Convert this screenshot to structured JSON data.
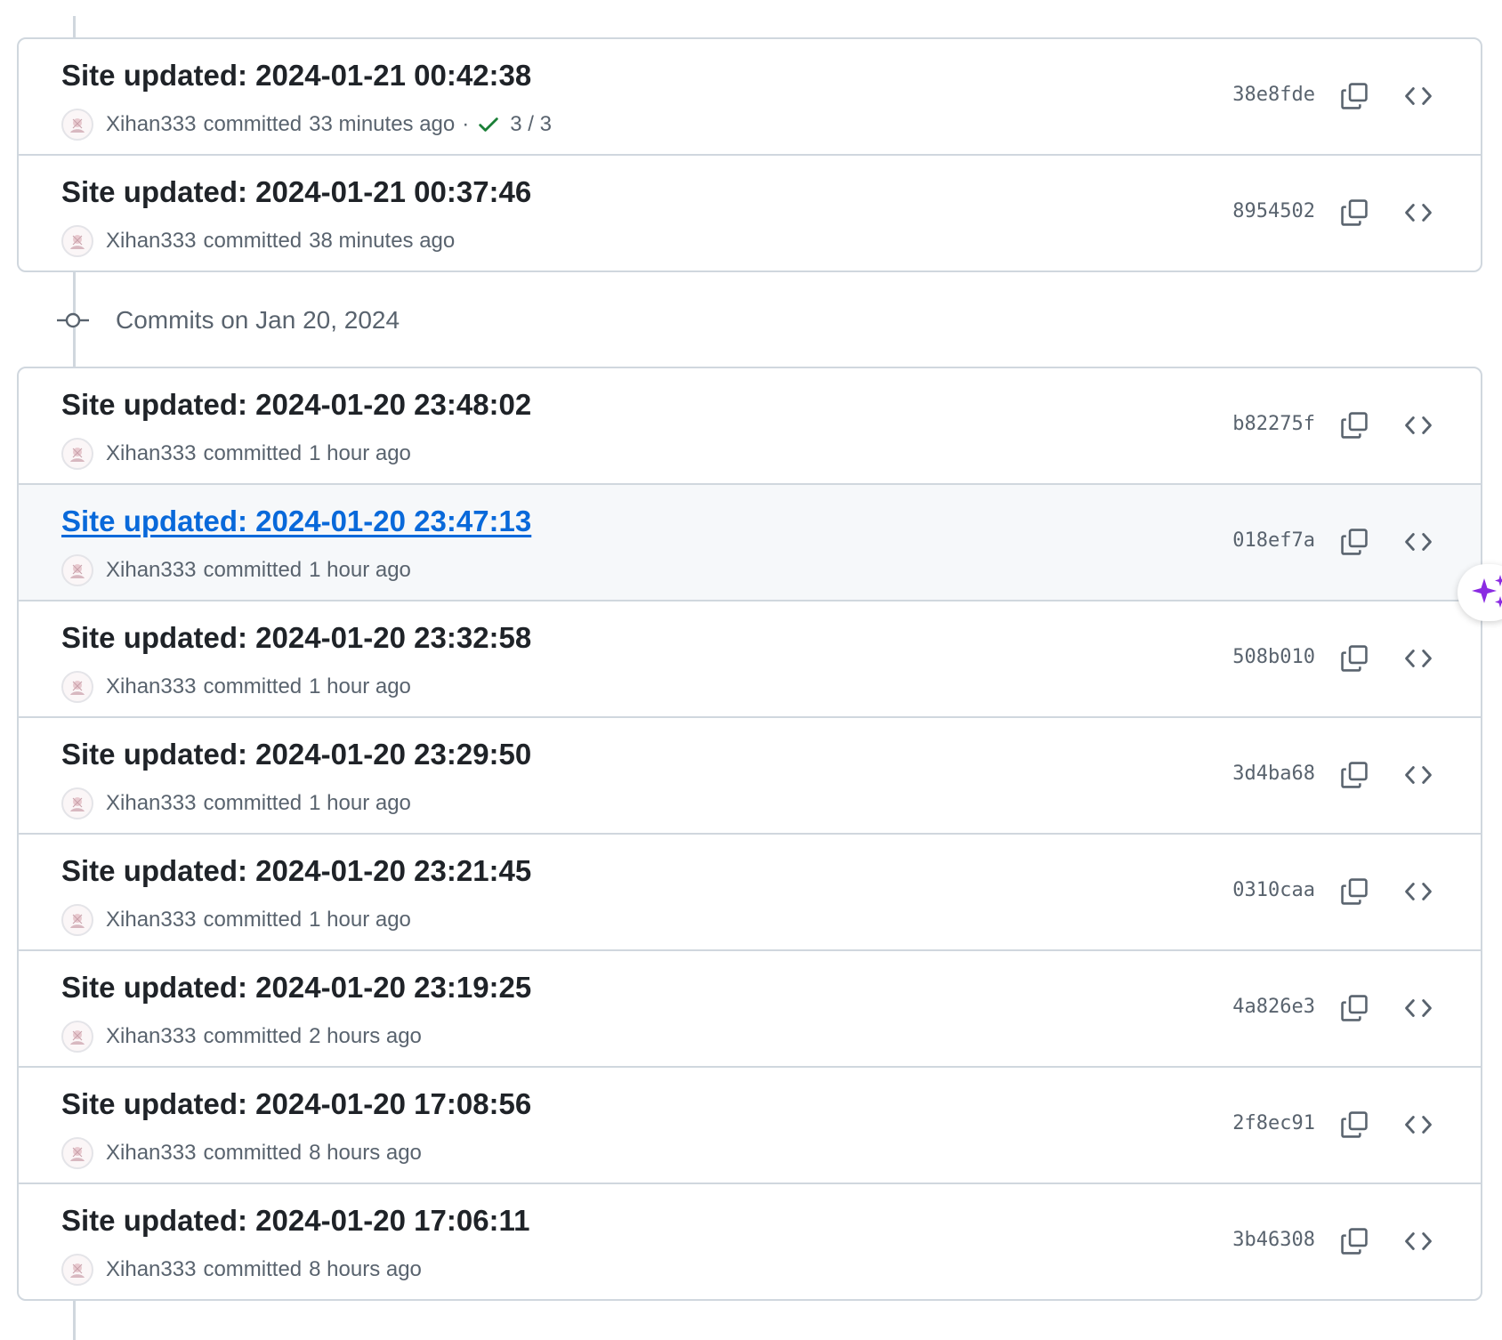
{
  "groups": [
    {
      "commits": [
        {
          "title": "Site updated: 2024-01-21 00:42:38",
          "author": "Xihan333",
          "action": "committed",
          "time": "33 minutes ago",
          "checks": "3 / 3",
          "sha": "38e8fde"
        },
        {
          "title": "Site updated: 2024-01-21 00:37:46",
          "author": "Xihan333",
          "action": "committed",
          "time": "38 minutes ago",
          "sha": "8954502"
        }
      ]
    },
    {
      "date_label": "Commits on Jan 20, 2024",
      "commits": [
        {
          "title": "Site updated: 2024-01-20 23:48:02",
          "author": "Xihan333",
          "action": "committed",
          "time": "1 hour ago",
          "sha": "b82275f"
        },
        {
          "title": "Site updated: 2024-01-20 23:47:13",
          "author": "Xihan333",
          "action": "committed",
          "time": "1 hour ago",
          "sha": "018ef7a",
          "hovered": true
        },
        {
          "title": "Site updated: 2024-01-20 23:32:58",
          "author": "Xihan333",
          "action": "committed",
          "time": "1 hour ago",
          "sha": "508b010"
        },
        {
          "title": "Site updated: 2024-01-20 23:29:50",
          "author": "Xihan333",
          "action": "committed",
          "time": "1 hour ago",
          "sha": "3d4ba68"
        },
        {
          "title": "Site updated: 2024-01-20 23:21:45",
          "author": "Xihan333",
          "action": "committed",
          "time": "1 hour ago",
          "sha": "0310caa"
        },
        {
          "title": "Site updated: 2024-01-20 23:19:25",
          "author": "Xihan333",
          "action": "committed",
          "time": "2 hours ago",
          "sha": "4a826e3"
        },
        {
          "title": "Site updated: 2024-01-20 17:08:56",
          "author": "Xihan333",
          "action": "committed",
          "time": "8 hours ago",
          "sha": "2f8ec91"
        },
        {
          "title": "Site updated: 2024-01-20 17:06:11",
          "author": "Xihan333",
          "action": "committed",
          "time": "8 hours ago",
          "sha": "3b46308"
        }
      ]
    }
  ],
  "icons": {
    "avatar": "avatar-image",
    "check": "check-icon",
    "copy": "copy-icon",
    "browse": "code-brackets-icon",
    "commit": "git-commit-icon",
    "copilot": "copilot-sparkle-icon"
  },
  "colors": {
    "link": "#0969da",
    "check": "#1a7f37",
    "copilot": "#8a2be2",
    "border": "#d0d7de"
  }
}
